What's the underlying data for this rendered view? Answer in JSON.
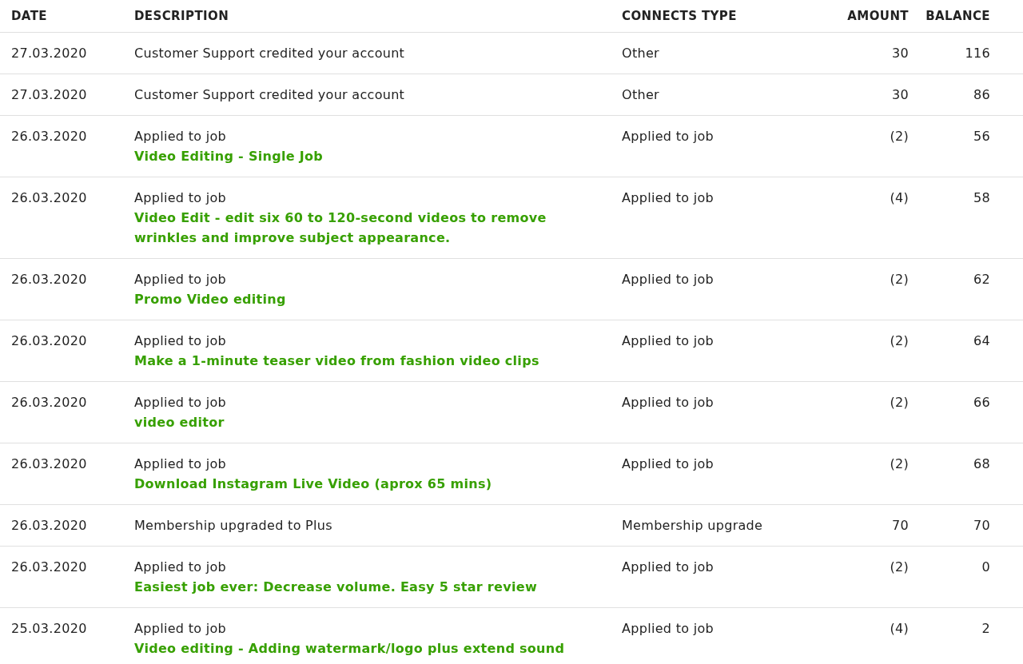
{
  "table": {
    "columns": [
      "DATE",
      "DESCRIPTION",
      "CONNECTS TYPE",
      "AMOUNT",
      "BALANCE"
    ],
    "rows": [
      {
        "date": "27.03.2020",
        "description": "Customer Support credited your account",
        "type": "Other",
        "amount": "30",
        "balance": "116"
      },
      {
        "date": "27.03.2020",
        "description": "Customer Support credited your account",
        "type": "Other",
        "amount": "30",
        "balance": "86"
      },
      {
        "date": "26.03.2020",
        "description": "Applied to job",
        "link": "Video Editing - Single Job",
        "type": "Applied to job",
        "amount": "(2)",
        "balance": "56"
      },
      {
        "date": "26.03.2020",
        "description": "Applied to job",
        "link": "Video Edit - edit six 60 to 120-second videos to remove wrinkles and improve subject appearance.",
        "type": "Applied to job",
        "amount": "(4)",
        "balance": "58"
      },
      {
        "date": "26.03.2020",
        "description": "Applied to job",
        "link": "Promo Video editing",
        "type": "Applied to job",
        "amount": "(2)",
        "balance": "62"
      },
      {
        "date": "26.03.2020",
        "description": "Applied to job",
        "link": "Make a 1-minute teaser video from fashion video clips",
        "type": "Applied to job",
        "amount": "(2)",
        "balance": "64"
      },
      {
        "date": "26.03.2020",
        "description": "Applied to job",
        "link": "video editor",
        "type": "Applied to job",
        "amount": "(2)",
        "balance": "66"
      },
      {
        "date": "26.03.2020",
        "description": "Applied to job",
        "link": "Download Instagram Live Video (aprox 65 mins)",
        "type": "Applied to job",
        "amount": "(2)",
        "balance": "68"
      },
      {
        "date": "26.03.2020",
        "description": "Membership upgraded to Plus",
        "type": "Membership upgrade",
        "amount": "70",
        "balance": "70"
      },
      {
        "date": "26.03.2020",
        "description": "Applied to job",
        "link": "Easiest job ever: Decrease volume. Easy 5 star review",
        "type": "Applied to job",
        "amount": "(2)",
        "balance": "0"
      },
      {
        "date": "25.03.2020",
        "description": "Applied to job",
        "link": "Video editing - Adding watermark/logo plus extend sound",
        "type": "Applied to job",
        "amount": "(4)",
        "balance": "2"
      }
    ]
  }
}
